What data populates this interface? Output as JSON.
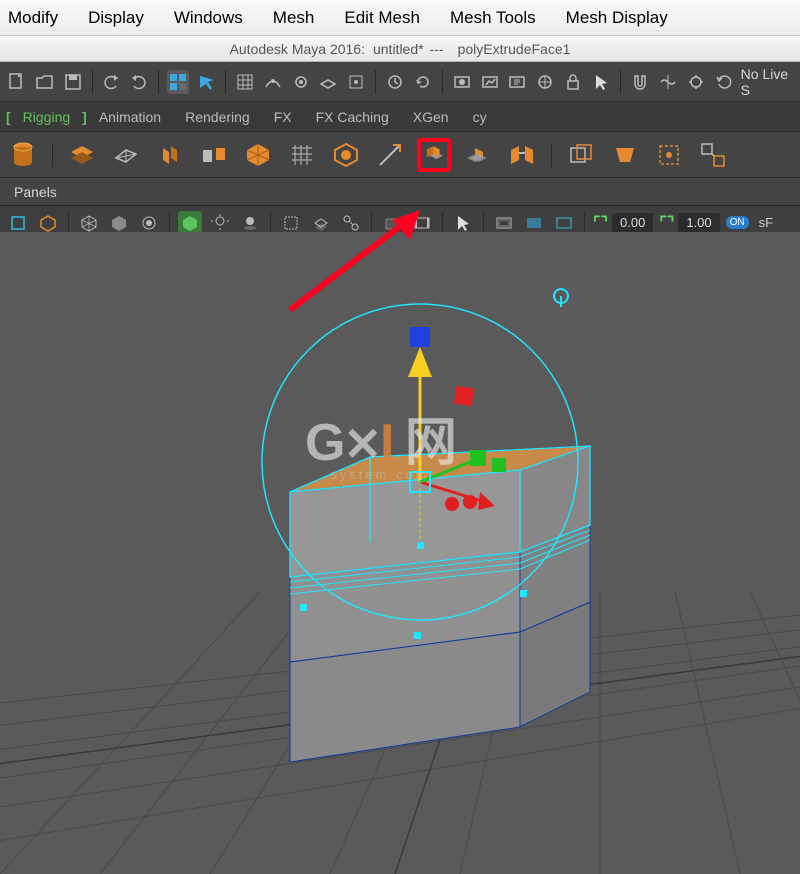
{
  "menu": {
    "items": [
      "Modify",
      "Display",
      "Windows",
      "Mesh",
      "Edit Mesh",
      "Mesh Tools",
      "Mesh Display"
    ]
  },
  "title": {
    "app": "Autodesk Maya 2016:",
    "doc": "untitled*",
    "sep": "---",
    "cmd": "polyExtrudeFace1"
  },
  "toolbar1": {
    "no_live": "No Live S"
  },
  "shelf": {
    "tabs": [
      "Rigging",
      "Animation",
      "Rendering",
      "FX",
      "FX Caching",
      "XGen",
      "cy"
    ],
    "active_index": 0
  },
  "panels": {
    "label": "Panels"
  },
  "vp_toolbar": {
    "val1": "0.00",
    "val2": "1.00",
    "on": "ON",
    "tail": "sF"
  },
  "colors": {
    "accent_orange": "#e68a2e",
    "accent_cyan": "#20e6ff",
    "highlight_red": "#ff0020",
    "grid_dark": "#4a4a4a"
  }
}
